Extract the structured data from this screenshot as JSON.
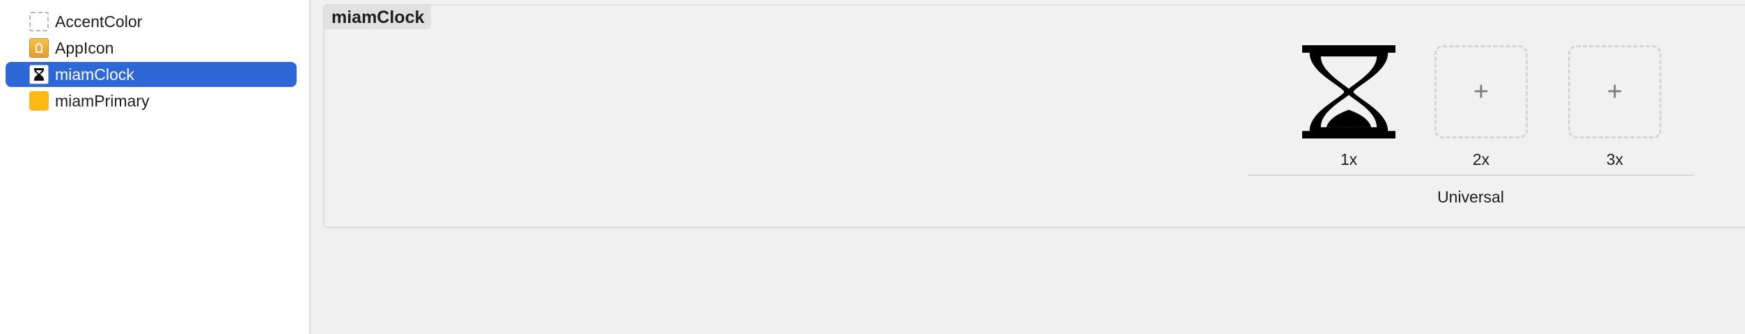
{
  "sidebar": {
    "items": [
      {
        "label": "AccentColor",
        "icon": "color-set-icon",
        "selected": false
      },
      {
        "label": "AppIcon",
        "icon": "app-icon-set-icon",
        "selected": false
      },
      {
        "label": "miamClock",
        "icon": "hourglass-thumbnail-icon",
        "selected": true
      },
      {
        "label": "miamPrimary",
        "icon": "color-swatch-icon",
        "selected": false
      }
    ]
  },
  "asset_set": {
    "title": "miamClock",
    "slots": [
      {
        "label": "1x",
        "filled": true,
        "icon": "hourglass-icon"
      },
      {
        "label": "2x",
        "filled": false,
        "placeholder": "+"
      },
      {
        "label": "3x",
        "filled": false,
        "placeholder": "+"
      }
    ],
    "group_label": "Universal"
  },
  "colors": {
    "selection": "#2d68d6",
    "primary_swatch": "#fcb813",
    "sidebar_bg": "#ffffff",
    "canvas_bg": "#f0f0f0"
  }
}
